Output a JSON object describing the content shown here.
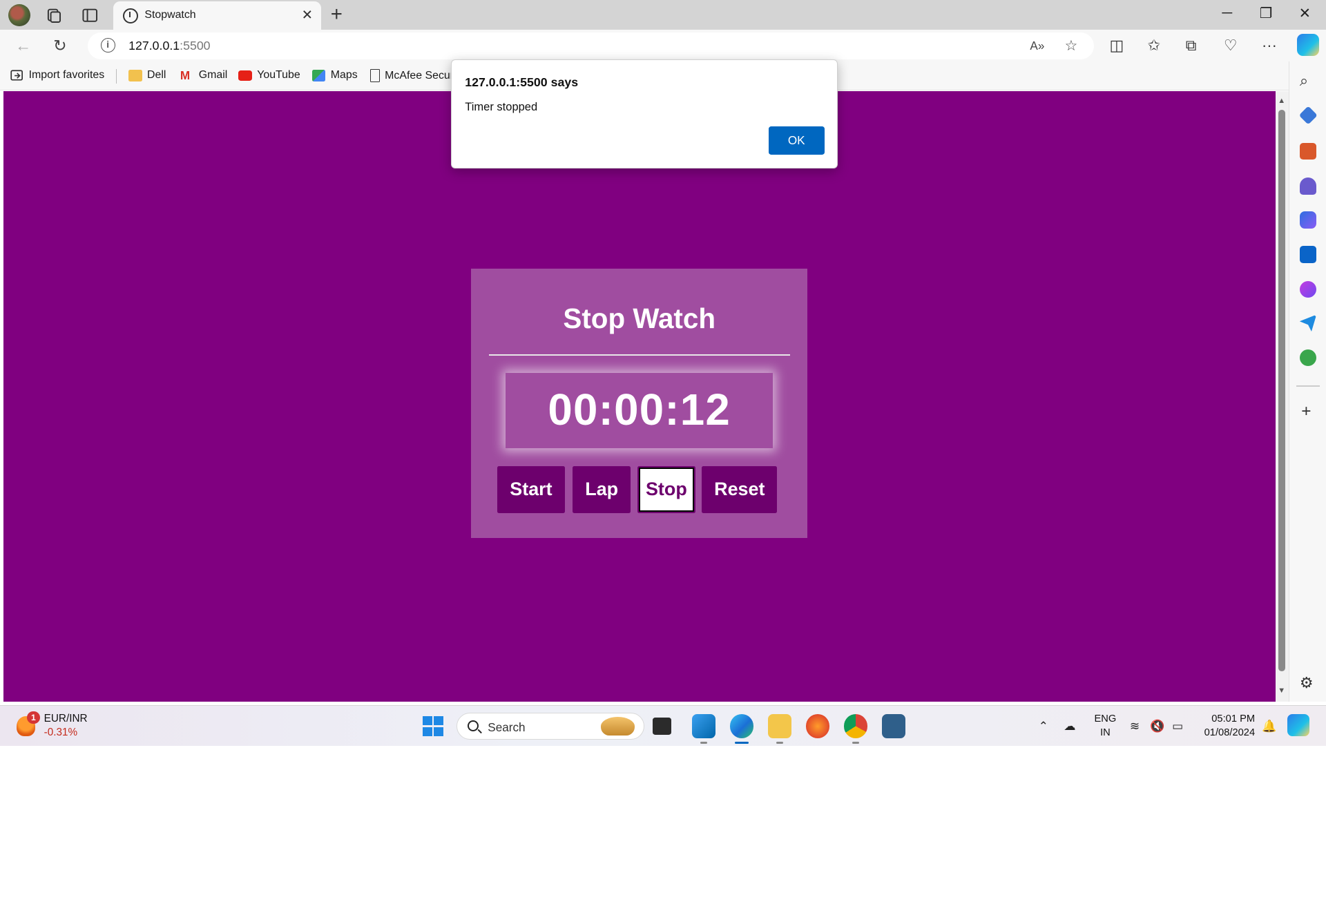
{
  "browser": {
    "tab_title": "Stopwatch",
    "url_host": "127.0.0.1",
    "url_port": ":5500"
  },
  "favorites": [
    {
      "label": "Import favorites"
    },
    {
      "label": "Dell"
    },
    {
      "label": "Gmail"
    },
    {
      "label": "YouTube"
    },
    {
      "label": "Maps"
    },
    {
      "label": "McAfee Secur"
    }
  ],
  "dialog": {
    "title": "127.0.0.1:5500 says",
    "message": "Timer stopped",
    "ok_label": "OK"
  },
  "stopwatch": {
    "title": "Stop Watch",
    "time": "00:00:12",
    "buttons": {
      "start": "Start",
      "lap": "Lap",
      "stop": "Stop",
      "reset": "Reset"
    }
  },
  "colors": {
    "page_bg": "#800080",
    "panel_bg": "#a04da0",
    "button_bg": "#6d006d",
    "dialog_button": "#0067c0"
  },
  "taskbar": {
    "ticker_badge": "1",
    "ticker_pair": "EUR/INR",
    "ticker_change": "-0.31%",
    "search_placeholder": "Search",
    "lang_line1": "ENG",
    "lang_line2": "IN",
    "time": "05:01 PM",
    "date": "01/08/2024"
  }
}
